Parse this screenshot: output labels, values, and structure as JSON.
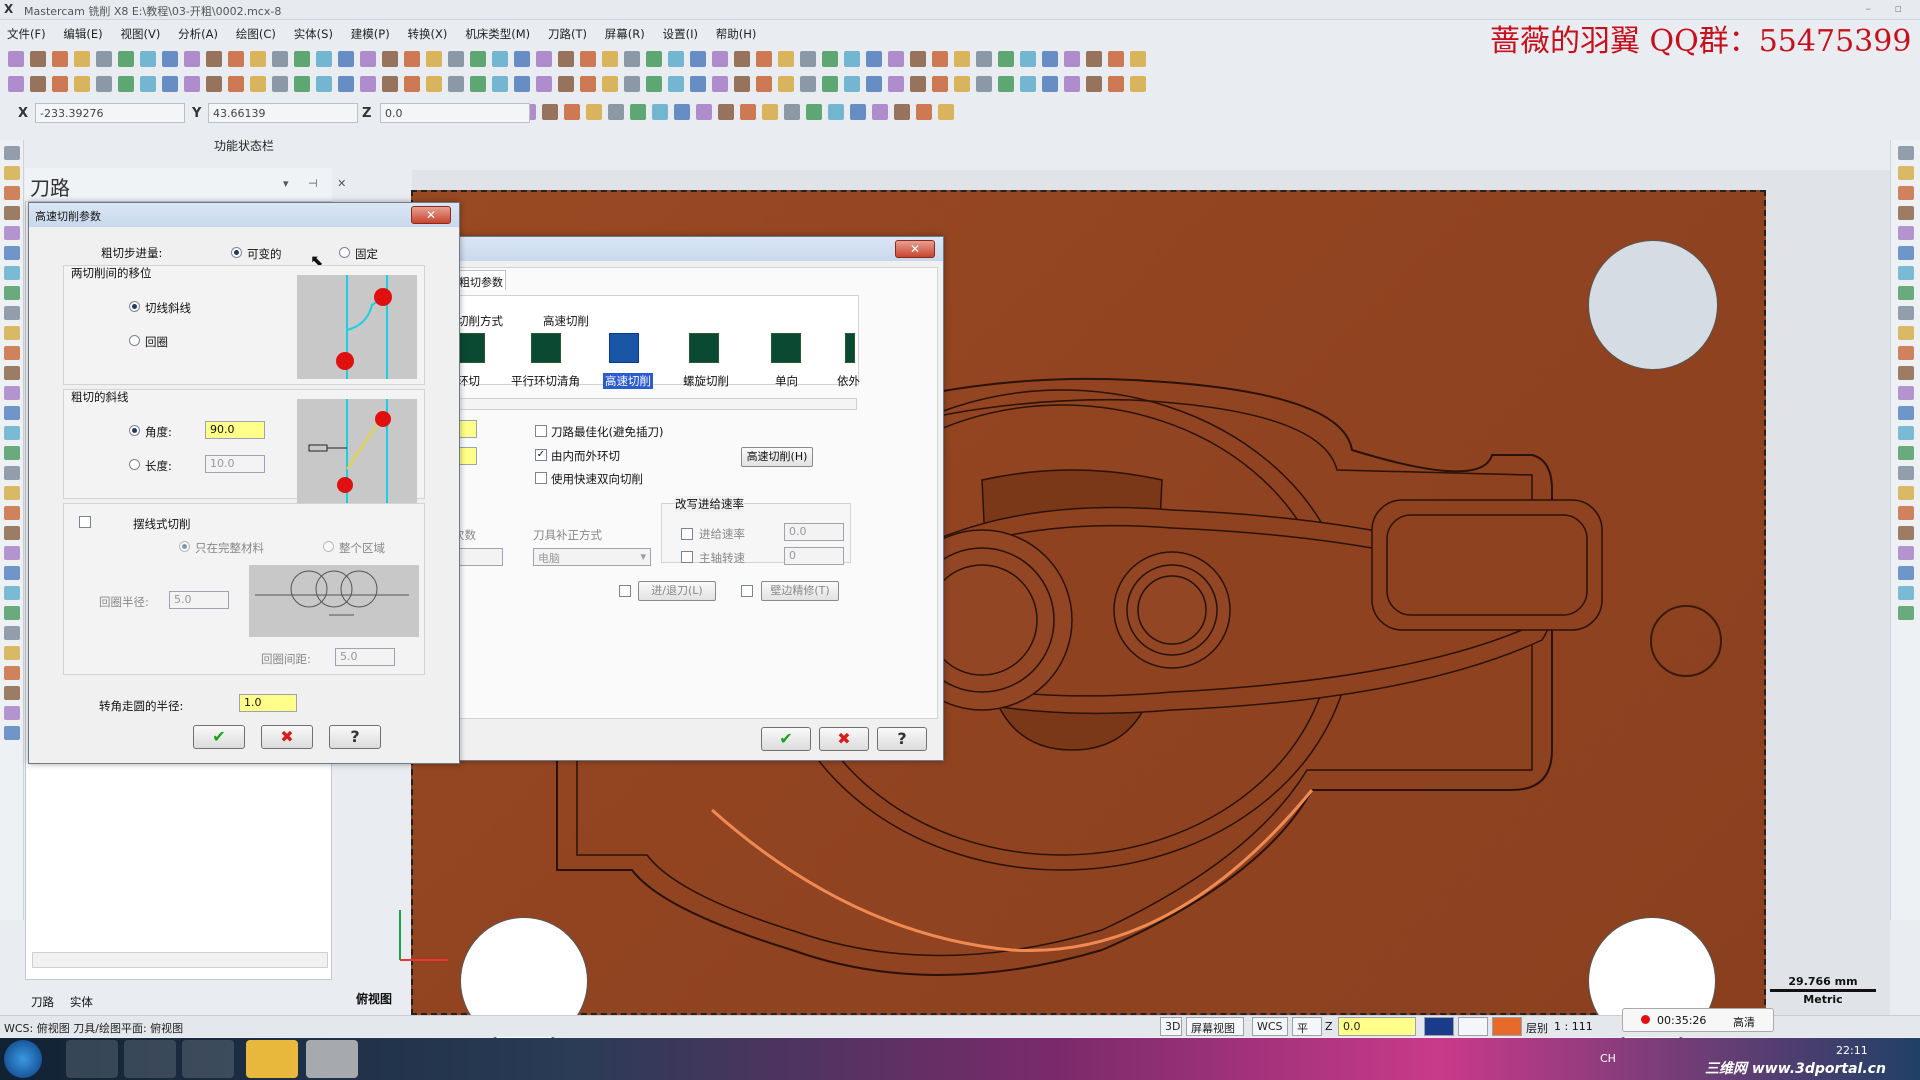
{
  "window": {
    "title": "Mastercam 铣削 X8  E:\\教程\\03-开粗\\0002.mcx-8",
    "watermark": "蔷薇的羽翼 QQ群：55475399"
  },
  "menubar": [
    "文件(F)",
    "编辑(E)",
    "视图(V)",
    "分析(A)",
    "绘图(C)",
    "实体(S)",
    "建模(P)",
    "转换(X)",
    "机床类型(M)",
    "刀路(T)",
    "屏幕(R)",
    "设置(I)",
    "帮助(H)"
  ],
  "coords": {
    "x_label": "X",
    "x_value": "-233.39276",
    "y_label": "Y",
    "y_value": "43.66139",
    "z_label": "Z",
    "z_value": "0.0"
  },
  "status_caption": "功能状态栏",
  "panel": {
    "title": "刀路",
    "tabs": [
      "刀路",
      "实体"
    ]
  },
  "viewport": {
    "view_label": "俯视图",
    "scale_value": "29.766 mm",
    "scale_unit": "Metric"
  },
  "dialog_hs": {
    "title": "高速切削参数",
    "rough_step_label": "粗切步进量:",
    "opt_variable": "可变的",
    "opt_fixed": "固定",
    "move_group": "两切削间的移位",
    "opt_tangent": "切线斜线",
    "opt_loop": "回圈",
    "ramp_group": "粗切的斜线",
    "angle_label": "角度:",
    "angle_value": "90.0",
    "length_label": "长度:",
    "length_value": "10.0",
    "trochoid_label": "摆线式切削",
    "opt_full_only": "只在完整材料",
    "opt_whole": "整个区域",
    "loop_radius_label": "回圈半径:",
    "loop_radius_value": "5.0",
    "loop_pitch_label": "回圈间距:",
    "loop_pitch_value": "5.0",
    "corner_radius_label": "转角走圆的半径:",
    "corner_radius_value": "1.0"
  },
  "dialog_main": {
    "tab_label": "粗切参数",
    "cut_method_label": "切削方式",
    "hs_cut_label": "高速切削",
    "methods": [
      "环切",
      "平行环切清角",
      "高速切削",
      "螺旋切削",
      "单向",
      "依外"
    ],
    "selected_method": "高速切削",
    "opt_toolpath_optimize": "刀路最佳化(避免插刀)",
    "opt_inside_out": "由内而外环切",
    "opt_fast_bidir": "使用快速双向切削",
    "hs_button": "高速切削(H)",
    "feed_override_group": "改写进给速率",
    "feed_rate_label": "进给速率",
    "feed_rate_value": "0.0",
    "spindle_label": "主轴转速",
    "spindle_value": "0",
    "passes_label": "次数",
    "comp_label": "刀具补正方式",
    "comp_value": "电脑",
    "lead_button": "进/退刀(L)",
    "finish_button": "壁边精修(T)"
  },
  "statusbar": {
    "left_text": "WCS: 俯视图  刀具/绘图平面: 俯视图",
    "btn_3d": "3D",
    "btn_screen_view": "屏幕视图",
    "btn_wcs": "WCS",
    "btn_plane": "平面",
    "z_label": "Z",
    "z_value": "0.0",
    "level_label": "层别",
    "level_value": "1 : 111",
    "rec_time": "00:35:26",
    "quality": "高清"
  },
  "taskbar": {
    "clock": "22:11",
    "site": "三维网 www.3dportal.cn",
    "ime": "CH"
  }
}
